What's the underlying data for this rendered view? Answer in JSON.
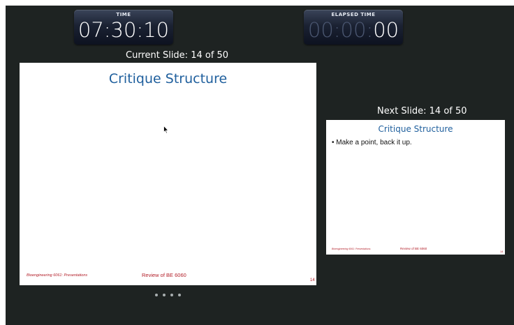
{
  "clocks": {
    "time_label": "TIME",
    "time_value": "07:30:10",
    "elapsed_label": "ELAPSED TIME",
    "elapsed_dim": "00:00:",
    "elapsed_bright": "00"
  },
  "current": {
    "caption": "Current Slide: 14 of 50",
    "title": "Critique Structure",
    "footer_left": "Bioengineering 6061: Presentations",
    "footer_center": "Review of BE 6060",
    "slide_number": "14"
  },
  "next": {
    "caption": "Next Slide: 14 of 50",
    "title": "Critique Structure",
    "bullet": "• Make a point, back it up.",
    "footer_left": "Bioengineering 6061: Presentations",
    "footer_center": "Review of BE 6060",
    "slide_number": "14"
  },
  "controls": {
    "dots": [
      "dot",
      "dot",
      "dot",
      "dot"
    ]
  },
  "icons": {
    "cursor": "mouse-pointer-icon"
  }
}
